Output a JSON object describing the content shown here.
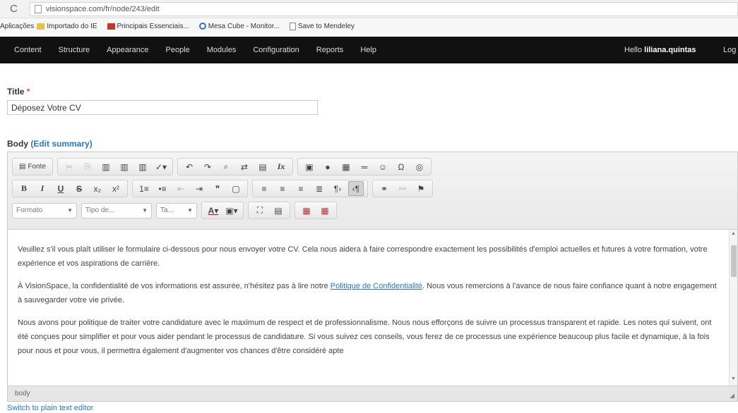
{
  "browser": {
    "url": "visionspace.com/fr/node/243/edit",
    "bookmarks": [
      {
        "label": "Aplicações",
        "icon": "apps-icon"
      },
      {
        "label": "Importado do IE",
        "icon": "folder-icon"
      },
      {
        "label": "Principais Essenciais...",
        "icon": "favicon-icon"
      },
      {
        "label": "Mesa Cube - Monitor...",
        "icon": "globe-icon"
      },
      {
        "label": "Save to Mendeley",
        "icon": "page-icon"
      }
    ]
  },
  "admin_toolbar": {
    "items": [
      "Content",
      "Structure",
      "Appearance",
      "People",
      "Modules",
      "Configuration",
      "Reports",
      "Help"
    ],
    "hello_prefix": "Hello",
    "username": "liliana.quintas",
    "logout": "Log"
  },
  "form": {
    "title_label": "Title",
    "required_mark": "*",
    "title_value": "Déposez Votre CV",
    "body_label": "Body",
    "edit_summary": "(Edit summary)",
    "switch_link": "Switch to plain text editor"
  },
  "editor": {
    "row1": [
      {
        "name": "source-button",
        "label": "Fonte",
        "icon": "source-icon"
      },
      {
        "name": "cut-button",
        "label": "✂",
        "disabled": true
      },
      {
        "name": "copy-button",
        "label": "⎘",
        "disabled": true
      },
      {
        "name": "paste-button",
        "label": "📋"
      },
      {
        "name": "paste-text-button",
        "label": "📋"
      },
      {
        "name": "paste-word-button",
        "label": "📋"
      },
      {
        "name": "spellcheck-button",
        "label": "ABC▾"
      },
      {
        "name": "undo-button",
        "label": "↶"
      },
      {
        "name": "redo-button",
        "label": "↷"
      },
      {
        "name": "find-button",
        "label": "🔍"
      },
      {
        "name": "replace-button",
        "label": "⇄"
      },
      {
        "name": "select-all-button",
        "label": "▤"
      },
      {
        "name": "remove-format-button",
        "label": "Ix"
      },
      {
        "name": "image-button",
        "label": "▣"
      },
      {
        "name": "flash-button",
        "label": "●"
      },
      {
        "name": "table-button",
        "label": "▦"
      },
      {
        "name": "hr-button",
        "label": "═"
      },
      {
        "name": "smiley-button",
        "label": "☺"
      },
      {
        "name": "special-char-button",
        "label": "Ω"
      },
      {
        "name": "iframe-button",
        "label": "◎"
      }
    ],
    "row2": [
      {
        "name": "bold-button",
        "label": "B"
      },
      {
        "name": "italic-button",
        "label": "I"
      },
      {
        "name": "underline-button",
        "label": "U"
      },
      {
        "name": "strike-button",
        "label": "S"
      },
      {
        "name": "subscript-button",
        "label": "x₂"
      },
      {
        "name": "superscript-button",
        "label": "x²"
      },
      {
        "name": "numbered-list-button",
        "label": "1≡"
      },
      {
        "name": "bullet-list-button",
        "label": "•≡"
      },
      {
        "name": "outdent-button",
        "label": "⇤",
        "disabled": true
      },
      {
        "name": "indent-button",
        "label": "⇥"
      },
      {
        "name": "blockquote-button",
        "label": "❞"
      },
      {
        "name": "div-button",
        "label": "▢"
      },
      {
        "name": "align-left-button",
        "label": "≡"
      },
      {
        "name": "align-center-button",
        "label": "≡"
      },
      {
        "name": "align-right-button",
        "label": "≡"
      },
      {
        "name": "justify-button",
        "label": "≣"
      },
      {
        "name": "ltr-button",
        "label": "¶›"
      },
      {
        "name": "rtl-button",
        "label": "‹¶",
        "active": true
      },
      {
        "name": "link-button",
        "label": "⚭"
      },
      {
        "name": "unlink-button",
        "label": "⚯",
        "disabled": true
      },
      {
        "name": "anchor-button",
        "label": "⚑"
      }
    ],
    "row3": {
      "format_combo": "Formato",
      "font_combo": "Tipo de...",
      "size_combo": "Ta...",
      "text_color": "A",
      "bg_color": "▣",
      "maximize": "⛶",
      "show_blocks": "▤",
      "template1": "▦",
      "template2": "▦"
    },
    "content": {
      "p1": "Veuillez s'il vous plaît utiliser le formulaire ci-dessous pour nous envoyer votre CV. Cela nous aidera à faire correspondre exactement les possibilités d'emploi actuelles et futures à votre formation, votre expérience et vos aspirations de carrière.",
      "p2_before": "À VisionSpace, la confidentialité de vos informations est assurée, n'hésitez pas à lire notre ",
      "p2_link": "Politique de Confidentialité",
      "p2_after": ". Nous vous remercions à l'avance de nous faire confiance quant à notre engagement à sauvegarder votre vie privée.",
      "p3": "Nous avons pour politique de traiter votre candidature avec le maximum de respect et de professionnalisme. Nous nous efforçons de suivre un processus transparent et rapide. Les notes qui suivent, ont été conçues pour simplifier et pour vous aider pendant le processus de candidature. Si vous suivez ces conseils, vous ferez de ce processus une expérience beaucoup plus facile et dynamique, à la fois pour nous et pour vous, il permettra également d'augmenter vos chances d'être considéré apte"
    },
    "status_path": "body"
  }
}
